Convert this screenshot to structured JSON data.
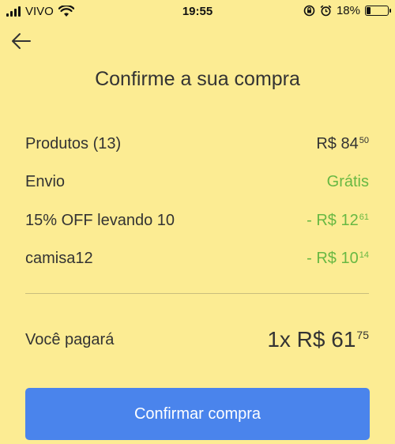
{
  "status_bar": {
    "carrier": "VIVO",
    "time": "19:55",
    "battery_percent": "18%",
    "battery_level": 0.18
  },
  "header": {
    "back_icon": "arrow-left-icon",
    "title": "Confirme a sua compra"
  },
  "summary": {
    "products": {
      "label": "Produtos (13)",
      "currency": "R$",
      "int": "84",
      "cents": "50"
    },
    "shipping": {
      "label": "Envio",
      "value": "Grátis"
    },
    "discount": {
      "label": "15% OFF levando 10",
      "prefix": "- R$",
      "int": "12",
      "cents": "61"
    },
    "coupon": {
      "label": "camisa12",
      "prefix": "- R$",
      "int": "10",
      "cents": "14"
    }
  },
  "total": {
    "label": "Você pagará",
    "prefix": "1x R$",
    "int": "61",
    "cents": "75"
  },
  "confirm_button": {
    "label": "Confirmar compra"
  },
  "colors": {
    "background": "#fcec93",
    "accent_green": "#68b843",
    "button_blue": "#4a84ec"
  }
}
